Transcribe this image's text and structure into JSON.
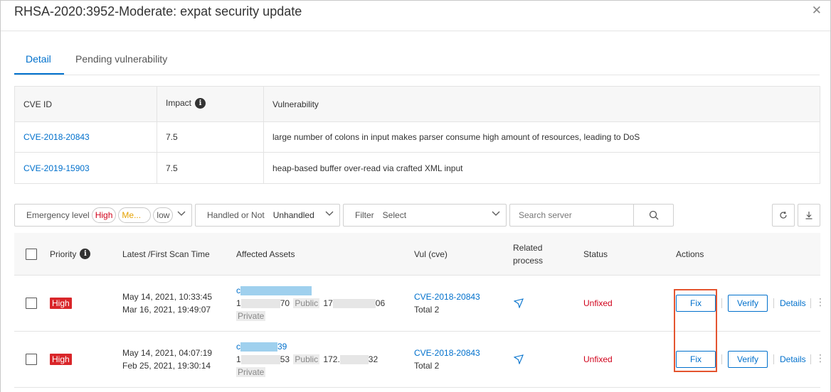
{
  "dialog": {
    "title": "RHSA-2020:3952-Moderate: expat security update",
    "close_glyph": "✕"
  },
  "tabs": [
    {
      "label": "Detail",
      "active": true
    },
    {
      "label": "Pending vulnerability",
      "active": false
    }
  ],
  "cve_table": {
    "headers": {
      "cve_id": "CVE ID",
      "impact": "Impact",
      "vulnerability": "Vulnerability"
    },
    "rows": [
      {
        "cve_id": "CVE-2018-20843",
        "impact": "7.5",
        "vulnerability": "large number of colons in input makes parser consume high amount of resources, leading to DoS"
      },
      {
        "cve_id": "CVE-2019-15903",
        "impact": "7.5",
        "vulnerability": "heap-based buffer over-read via crafted XML input"
      }
    ]
  },
  "filters": {
    "emergency": {
      "label": "Emergency level",
      "high": "High",
      "medium": "Me...",
      "low": "low"
    },
    "handled": {
      "label": "Handled or Not",
      "value": "Unhandled"
    },
    "filter": {
      "label": "Filter",
      "value": "Select"
    },
    "search": {
      "placeholder": "Search server"
    }
  },
  "toolbar": {
    "refresh_icon": "refresh-icon",
    "download_icon": "download-icon"
  },
  "main_table": {
    "headers": {
      "priority": "Priority",
      "scan_time": "Latest /First Scan Time",
      "assets": "Affected Assets",
      "vul": "Vul (cve)",
      "related_1": "Related",
      "related_2": "process",
      "status": "Status",
      "actions": "Actions"
    },
    "rows": [
      {
        "priority": "High",
        "latest_scan": "May 14, 2021, 10:33:45",
        "first_scan": "Mar 16, 2021, 19:49:07",
        "asset_name_prefix": "c",
        "asset_ip_prefix": "1",
        "asset_ip_suffix": "70",
        "public_tag": "Public",
        "private_ip_prefix": "17",
        "private_ip_suffix": "06",
        "private_tag": "Private",
        "vul": "CVE-2018-20843",
        "vul_total": "Total 2",
        "status": "Unfixed",
        "fix": "Fix",
        "verify": "Verify",
        "details": "Details"
      },
      {
        "priority": "High",
        "latest_scan": "May 14, 2021, 04:07:19",
        "first_scan": "Feb 25, 2021, 19:30:14",
        "asset_name_prefix": "c",
        "asset_name_suffix": "39",
        "asset_ip_prefix": "1",
        "asset_ip_suffix": "53",
        "public_tag": "Public",
        "private_ip_prefix": "172.",
        "private_ip_suffix": "32",
        "private_tag": "Private",
        "vul": "CVE-2018-20843",
        "vul_total": "Total 2",
        "status": "Unfixed",
        "fix": "Fix",
        "verify": "Verify",
        "details": "Details"
      }
    ]
  },
  "colors": {
    "accent": "#0070cc",
    "danger": "#d9262a",
    "highlight": "#e4542f"
  }
}
